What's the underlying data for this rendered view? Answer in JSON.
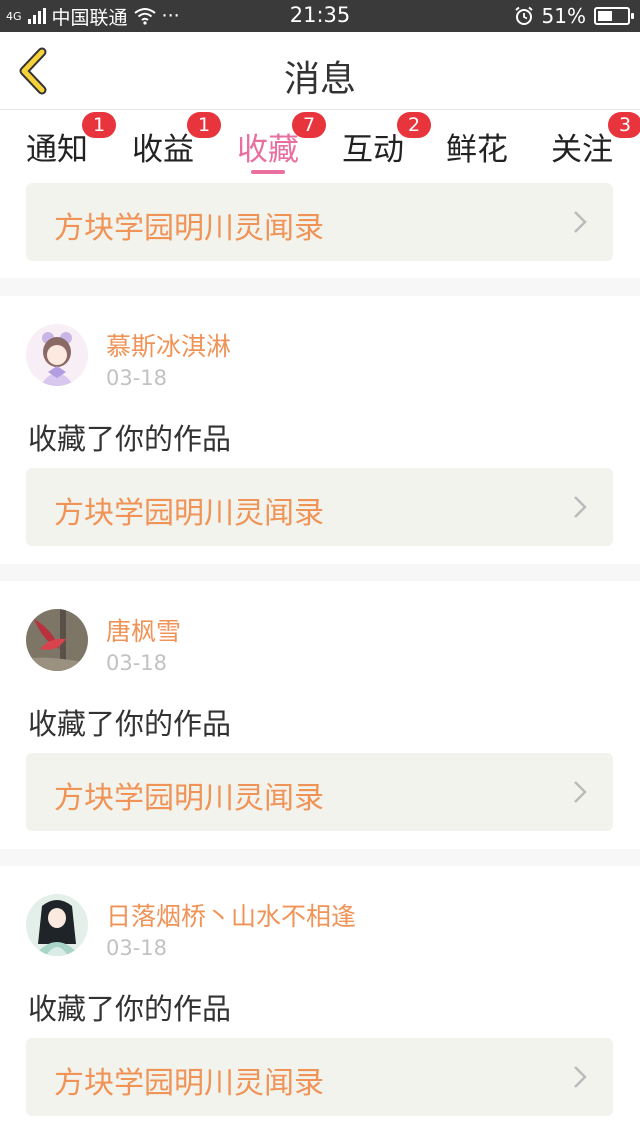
{
  "status_bar": {
    "network": "4G",
    "carrier": "中国联通",
    "dots": "···",
    "time": "21:35",
    "battery_text": "51%",
    "battery_level": 0.51
  },
  "header": {
    "title": "消息"
  },
  "tabs": [
    {
      "label": "通知",
      "badge": "1",
      "active": false
    },
    {
      "label": "收益",
      "badge": "1",
      "active": false
    },
    {
      "label": "收藏",
      "badge": "7",
      "active": true
    },
    {
      "label": "互动",
      "badge": "2",
      "active": false
    },
    {
      "label": "鲜花",
      "badge": "",
      "active": false
    },
    {
      "label": "关注",
      "badge": "3",
      "active": false
    }
  ],
  "top_work": {
    "title": "方块学园明川灵闻录"
  },
  "items": [
    {
      "user": "慕斯冰淇淋",
      "date": "03-18",
      "action": "收藏了你的作品",
      "work": "方块学园明川灵闻录"
    },
    {
      "user": "唐枫雪",
      "date": "03-18",
      "action": "收藏了你的作品",
      "work": "方块学园明川灵闻录"
    },
    {
      "user": "日落烟桥丶山水不相逢",
      "date": "03-18",
      "action": "收藏了你的作品",
      "work": "方块学园明川灵闻录"
    }
  ],
  "colors": {
    "accent": "#e96fa0",
    "orange": "#f09357",
    "badge": "#e8343c"
  }
}
